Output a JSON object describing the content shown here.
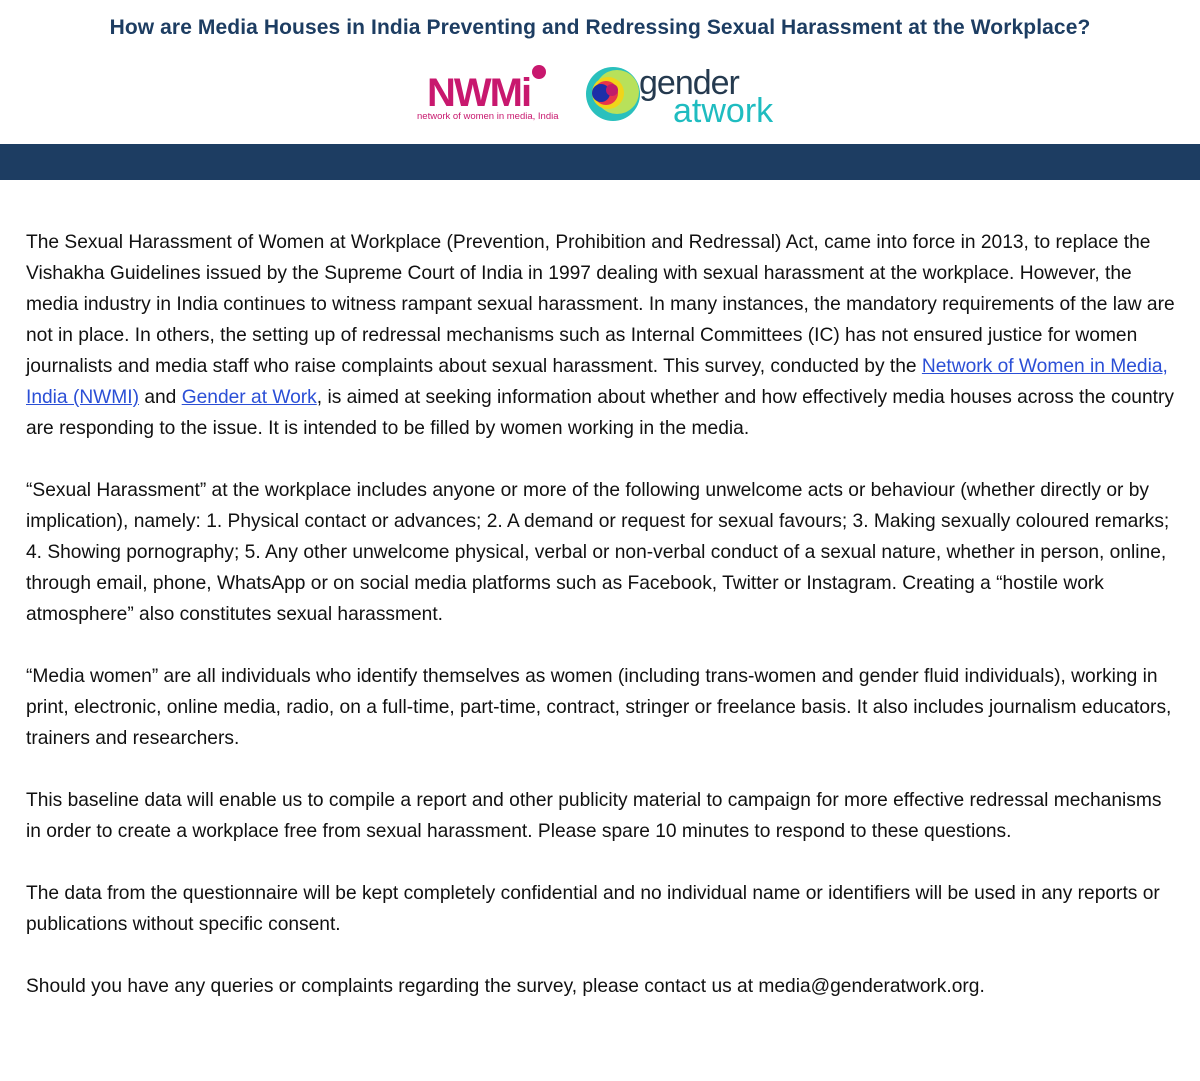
{
  "header": {
    "title": "How are Media Houses in India Preventing and Redressing Sexual Harassment at the Workplace?"
  },
  "logos": {
    "nwmi": {
      "wordmark": "NWMi",
      "tagline": "network of women in media, India"
    },
    "gender_at_work": {
      "line1": "gender",
      "line2": "atwork"
    }
  },
  "colors": {
    "banner": "#1d3d62",
    "title": "#1d3d62",
    "link": "#2b4fd6",
    "nwmi_pink": "#c8186e",
    "gaw_teal": "#1fbcc0",
    "gaw_dark": "#253a4f"
  },
  "body": {
    "p1": {
      "before": "The Sexual Harassment of Women at Workplace (Prevention, Prohibition and Redressal) Act, came into force in 2013, to replace the Vishakha Guidelines issued by the Supreme Court of India in 1997 dealing with sexual harassment at the workplace. However, the media industry in India continues to witness rampant sexual harassment. In many instances, the mandatory requirements of the law are not in place. In others, the setting up of redressal mechanisms such as Internal Committees (IC) has not ensured justice for women journalists and media staff who raise complaints about sexual harassment. This survey, conducted by the ",
      "link1": "Network of Women in Media, India (NWMI)",
      "middle": " and ",
      "link2": "Gender at Work",
      "after": ", is aimed at seeking information about whether and how effectively media houses across the country are responding to the issue. It is intended to be filled by women working in the media."
    },
    "p2": "“Sexual Harassment” at the workplace includes anyone or more of the following unwelcome acts or behaviour (whether directly or by implication), namely: 1. Physical contact or advances; 2. A demand or request for sexual favours; 3. Making sexually coloured remarks; 4. Showing pornography; 5. Any other unwelcome physical, verbal or non-verbal conduct of a sexual nature, whether in person, online, through email, phone, WhatsApp or on social media platforms such as Facebook, Twitter or Instagram. Creating a “hostile work atmosphere” also constitutes sexual harassment.",
    "p3": "“Media women” are all individuals who identify themselves as women (including trans-women and gender fluid individuals), working in print, electronic, online media, radio, on a full-time, part-time, contract, stringer or freelance basis. It also includes journalism educators, trainers and researchers.",
    "p4": "This baseline data will enable us to compile a report and other publicity material to campaign for more effective redressal mechanisms in order to create a workplace free from sexual harassment. Please spare 10 minutes to respond to these questions.",
    "p5": "The data from the questionnaire will be kept completely confidential and no individual name or identifiers will be used in any reports or publications without specific consent.",
    "p6": "Should you have any queries or complaints regarding the survey, please contact us at media@genderatwork.org."
  }
}
